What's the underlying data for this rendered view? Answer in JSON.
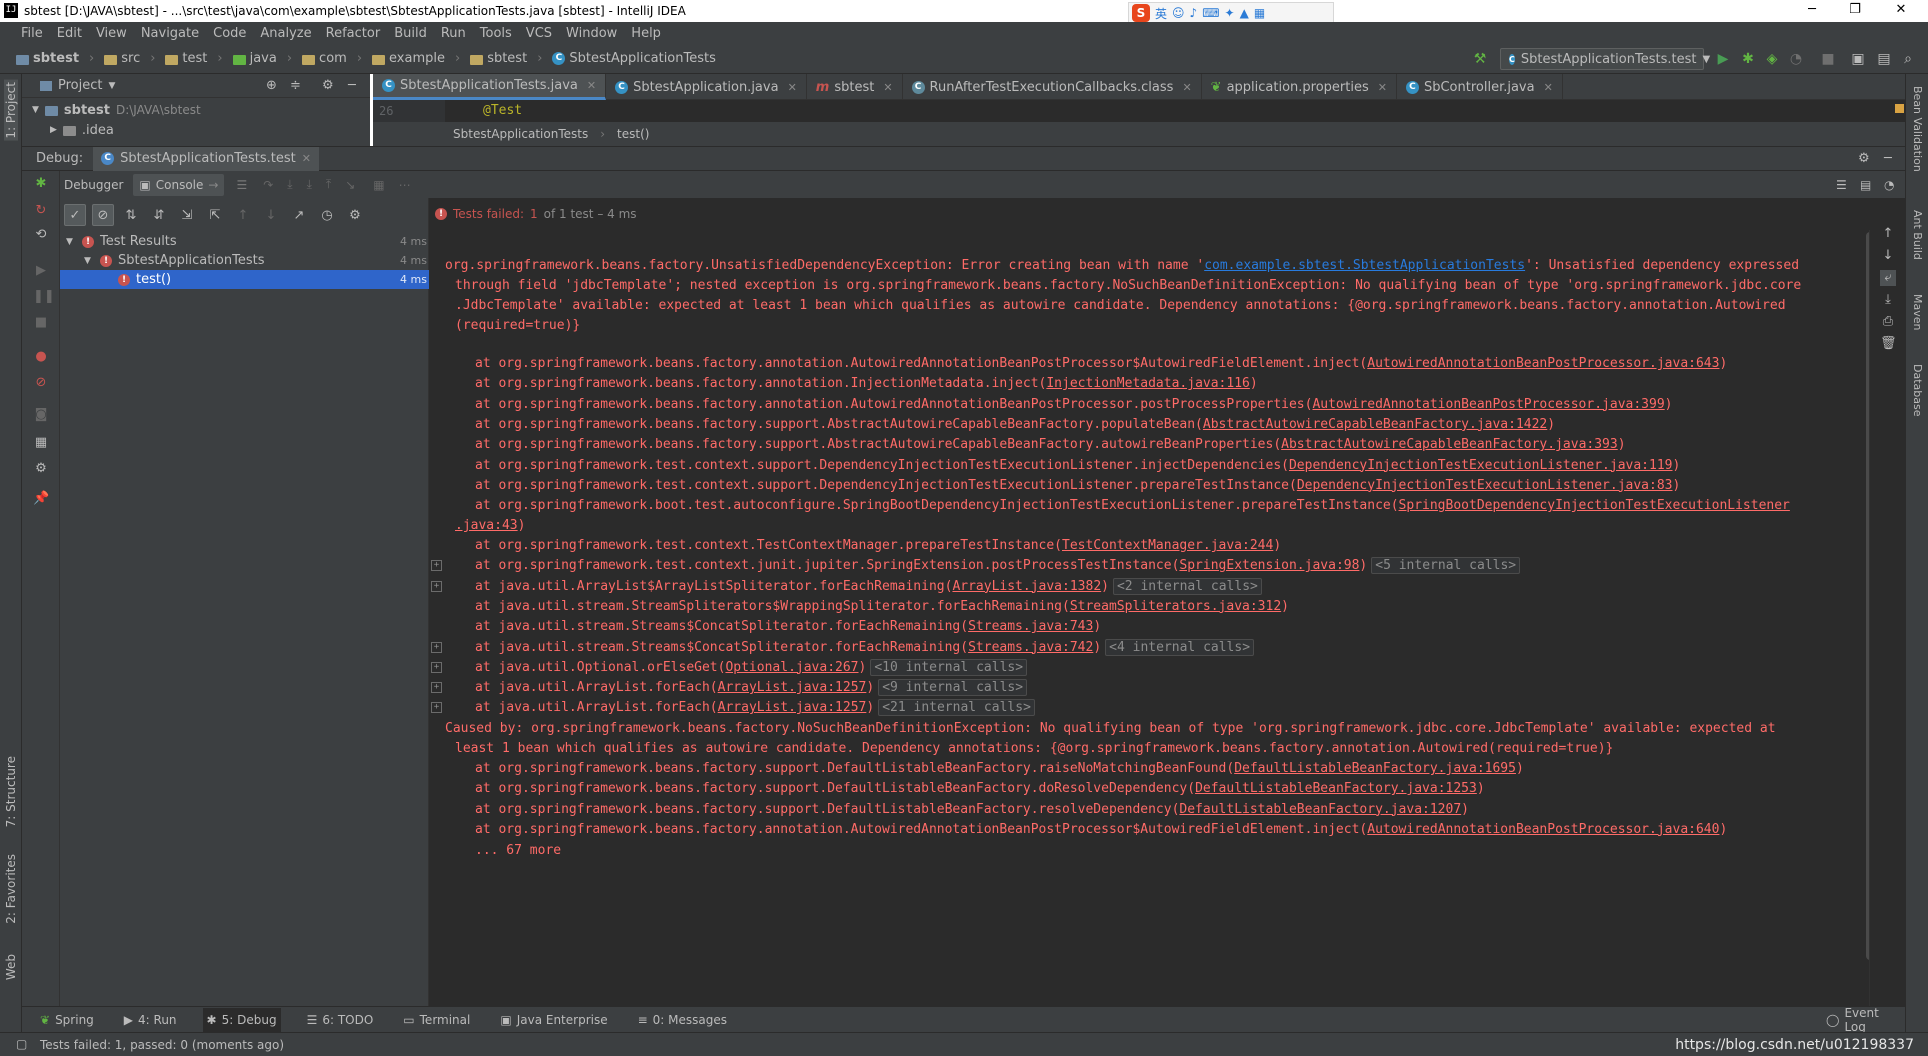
{
  "window": {
    "title": "sbtest [D:\\JAVA\\sbtest] - ...\\src\\test\\java\\com\\example\\sbtest\\SbtestApplicationTests.java [sbtest] - IntelliJ IDEA",
    "ime_label": "英"
  },
  "menu": [
    "File",
    "Edit",
    "View",
    "Navigate",
    "Code",
    "Analyze",
    "Refactor",
    "Build",
    "Run",
    "Tools",
    "VCS",
    "Window",
    "Help"
  ],
  "breadcrumb": [
    "sbtest",
    "src",
    "test",
    "java",
    "com",
    "example",
    "sbtest",
    "SbtestApplicationTests"
  ],
  "run_config": "SbtestApplicationTests.test",
  "project": {
    "header": "Project",
    "root_name": "sbtest",
    "root_path": "D:\\JAVA\\sbtest",
    "child": ".idea"
  },
  "editor_tabs": [
    {
      "label": "SbtestApplicationTests.java",
      "active": true
    },
    {
      "label": "SbtestApplication.java",
      "active": false
    },
    {
      "label": "sbtest",
      "active": false
    },
    {
      "label": "RunAfterTestExecutionCallbacks.class",
      "active": false
    },
    {
      "label": "application.properties",
      "active": false
    },
    {
      "label": "SbController.java",
      "active": false
    }
  ],
  "editor": {
    "line_number": "26",
    "code": "@Test",
    "breadcrumb_class": "SbtestApplicationTests",
    "breadcrumb_method": "test()"
  },
  "debug": {
    "label": "Debug:",
    "tab": "SbtestApplicationTests.test",
    "subtabs": [
      "Debugger",
      "Console"
    ]
  },
  "test_tree": [
    {
      "label": "Test Results",
      "duration": "4 ms"
    },
    {
      "label": "SbtestApplicationTests",
      "duration": "4 ms"
    },
    {
      "label": "test()",
      "duration": "4 ms"
    }
  ],
  "console": {
    "status_failed": "Tests failed:",
    "status_count": "1",
    "status_rest": "of 1 test – 4 ms",
    "exception_prefix": "org.springframework.beans.factory.UnsatisfiedDependencyException: Error creating bean with name '",
    "exception_bean": "com.example.sbtest.SbtestApplicationTests",
    "exception_suffix": "': Unsatisfied dependency expressed",
    "exception_l2": "through field 'jdbcTemplate'; nested exception is org.springframework.beans.factory.NoSuchBeanDefinitionException: No qualifying bean of type 'org.springframework.jdbc.core",
    "exception_l3": ".JdbcTemplate' available: expected at least 1 bean which qualifies as autowire candidate. Dependency annotations: {@org.springframework.beans.factory.annotation.Autowired",
    "exception_l4": "(required=true)}",
    "frames": [
      {
        "method": "at org.springframework.beans.factory.annotation.AutowiredAnnotationBeanPostProcessor$AutowiredFieldElement.inject(",
        "link": "AutowiredAnnotationBeanPostProcessor.java:643",
        "end": ")",
        "internal": ""
      },
      {
        "method": "at org.springframework.beans.factory.annotation.InjectionMetadata.inject(",
        "link": "InjectionMetadata.java:116",
        "end": ")",
        "internal": ""
      },
      {
        "method": "at org.springframework.beans.factory.annotation.AutowiredAnnotationBeanPostProcessor.postProcessProperties(",
        "link": "AutowiredAnnotationBeanPostProcessor.java:399",
        "end": ")",
        "internal": ""
      },
      {
        "method": "at org.springframework.beans.factory.support.AbstractAutowireCapableBeanFactory.populateBean(",
        "link": "AbstractAutowireCapableBeanFactory.java:1422",
        "end": ")",
        "internal": ""
      },
      {
        "method": "at org.springframework.beans.factory.support.AbstractAutowireCapableBeanFactory.autowireBeanProperties(",
        "link": "AbstractAutowireCapableBeanFactory.java:393",
        "end": ")",
        "internal": ""
      },
      {
        "method": "at org.springframework.test.context.support.DependencyInjectionTestExecutionListener.injectDependencies(",
        "link": "DependencyInjectionTestExecutionListener.java:119",
        "end": ")",
        "internal": ""
      },
      {
        "method": "at org.springframework.test.context.support.DependencyInjectionTestExecutionListener.prepareTestInstance(",
        "link": "DependencyInjectionTestExecutionListener.java:83",
        "end": ")",
        "internal": ""
      }
    ],
    "boot_frame": "at org.springframework.boot.test.autoconfigure.SpringBootDependencyInjectionTestExecutionListener.prepareTestInstance(",
    "boot_link1": "SpringBootDependencyInjectionTestExecutionListener",
    "boot_link2": ".java:43",
    "frames2": [
      {
        "method": "at org.springframework.test.context.TestContextManager.prepareTestInstance(",
        "link": "TestContextManager.java:244",
        "end": ")",
        "internal": ""
      },
      {
        "method": "at org.springframework.test.context.junit.jupiter.SpringExtension.postProcessTestInstance(",
        "link": "SpringExtension.java:98",
        "end": ")",
        "internal": "<5 internal calls>"
      },
      {
        "method": "at java.util.ArrayList$ArrayListSpliterator.forEachRemaining(",
        "link": "ArrayList.java:1382",
        "end": ")",
        "internal": "<2 internal calls>"
      },
      {
        "method": "at java.util.stream.StreamSpliterators$WrappingSpliterator.forEachRemaining(",
        "link": "StreamSpliterators.java:312",
        "end": ")",
        "internal": ""
      },
      {
        "method": "at java.util.stream.Streams$ConcatSpliterator.forEachRemaining(",
        "link": "Streams.java:743",
        "end": ")",
        "internal": ""
      },
      {
        "method": "at java.util.stream.Streams$ConcatSpliterator.forEachRemaining(",
        "link": "Streams.java:742",
        "end": ")",
        "internal": "<4 internal calls>"
      },
      {
        "method": "at java.util.Optional.orElseGet(",
        "link": "Optional.java:267",
        "end": ")",
        "internal": "<10 internal calls>"
      },
      {
        "method": "at java.util.ArrayList.forEach(",
        "link": "ArrayList.java:1257",
        "end": ")",
        "internal": "<9 internal calls>"
      },
      {
        "method": "at java.util.ArrayList.forEach(",
        "link": "ArrayList.java:1257",
        "end": ")",
        "internal": "<21 internal calls>"
      }
    ],
    "caused_l1": "Caused by: org.springframework.beans.factory.NoSuchBeanDefinitionException: No qualifying bean of type 'org.springframework.jdbc.core.JdbcTemplate' available: expected at",
    "caused_l2": "least 1 bean which qualifies as autowire candidate. Dependency annotations: {@org.springframework.beans.factory.annotation.Autowired(required=true)}",
    "frames3": [
      {
        "method": "at org.springframework.beans.factory.support.DefaultListableBeanFactory.raiseNoMatchingBeanFound(",
        "link": "DefaultListableBeanFactory.java:1695",
        "end": ")",
        "internal": ""
      },
      {
        "method": "at org.springframework.beans.factory.support.DefaultListableBeanFactory.doResolveDependency(",
        "link": "DefaultListableBeanFactory.java:1253",
        "end": ")",
        "internal": ""
      },
      {
        "method": "at org.springframework.beans.factory.support.DefaultListableBeanFactory.resolveDependency(",
        "link": "DefaultListableBeanFactory.java:1207",
        "end": ")",
        "internal": ""
      },
      {
        "method": "at org.springframework.beans.factory.annotation.AutowiredAnnotationBeanPostProcessor$AutowiredFieldElement.inject(",
        "link": "AutowiredAnnotationBeanPostProcessor.java:640",
        "end": ")",
        "internal": ""
      }
    ],
    "more": "... 67 more"
  },
  "left_vtabs": [
    "1: Project",
    "7: Structure",
    "2: Favorites",
    "Web"
  ],
  "right_vtabs": [
    "Bean Validation",
    "Ant Build",
    "Maven",
    "Database"
  ],
  "bottom_tabs": [
    {
      "label": "Spring",
      "active": false,
      "icon": "spring-icon"
    },
    {
      "label": "4: Run",
      "active": false,
      "icon": "run-icon"
    },
    {
      "label": "5: Debug",
      "active": true,
      "icon": "debug-icon"
    },
    {
      "label": "6: TODO",
      "active": false,
      "icon": "todo-icon"
    },
    {
      "label": "Terminal",
      "active": false,
      "icon": "terminal-icon"
    },
    {
      "label": "Java Enterprise",
      "active": false,
      "icon": "java-enterprise-icon"
    },
    {
      "label": "0: Messages",
      "active": false,
      "icon": "messages-icon"
    }
  ],
  "event_log": "Event Log",
  "status": "Tests failed: 1, passed: 0 (moments ago)",
  "watermark": "https://blog.csdn.net/u012198337",
  "colors": {
    "accent": "#4a88c7",
    "error": "#ff6b68",
    "selection": "#2f65ca",
    "link": "#287bde"
  }
}
